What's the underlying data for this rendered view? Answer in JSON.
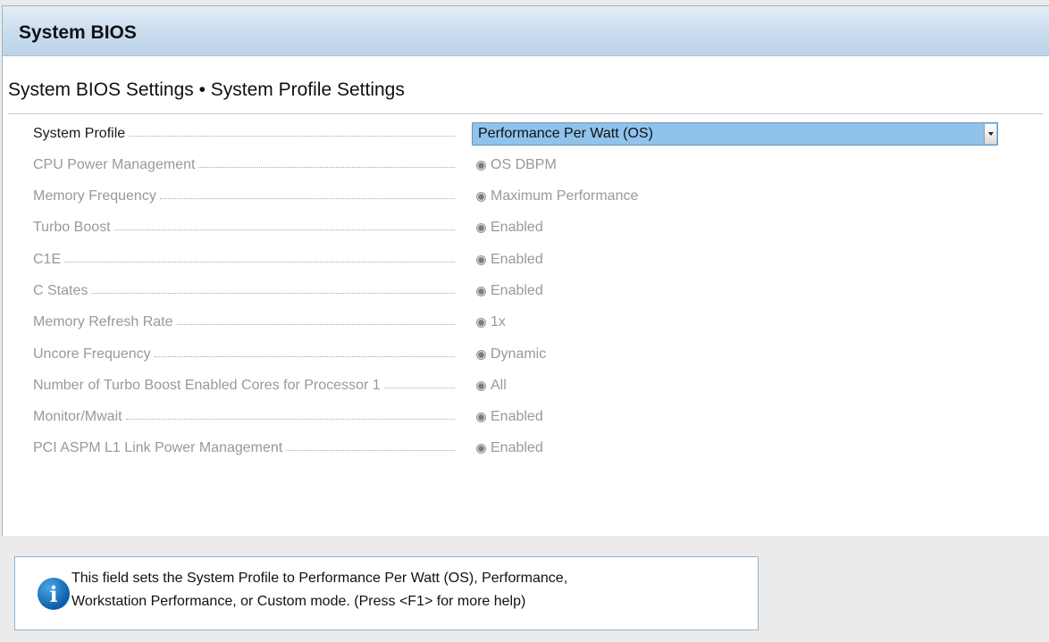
{
  "header": {
    "title": "System BIOS"
  },
  "section": {
    "title": "System BIOS Settings • System Profile Settings"
  },
  "settings": [
    {
      "label": "System Profile",
      "value": "Performance Per Watt (OS)",
      "type": "select",
      "active": true
    },
    {
      "label": "CPU Power Management",
      "value": "OS DBPM",
      "type": "radio",
      "active": false
    },
    {
      "label": "Memory Frequency",
      "value": "Maximum Performance",
      "type": "radio",
      "active": false
    },
    {
      "label": "Turbo Boost",
      "value": "Enabled",
      "type": "radio",
      "active": false
    },
    {
      "label": "C1E",
      "value": "Enabled",
      "type": "radio",
      "active": false
    },
    {
      "label": "C States",
      "value": "Enabled",
      "type": "radio",
      "active": false
    },
    {
      "label": "Memory Refresh Rate",
      "value": "1x",
      "type": "radio",
      "active": false
    },
    {
      "label": "Uncore Frequency",
      "value": "Dynamic",
      "type": "radio",
      "active": false
    },
    {
      "label": "Number of Turbo Boost Enabled Cores for Processor 1",
      "value": "All",
      "type": "radio",
      "active": false
    },
    {
      "label": "Monitor/Mwait",
      "value": "Enabled",
      "type": "radio",
      "active": false
    },
    {
      "label": "PCI ASPM L1 Link Power Management",
      "value": "Enabled",
      "type": "radio",
      "active": false
    }
  ],
  "help": {
    "icon": "info-icon",
    "text_line1": "This field sets the System Profile to Performance Per Watt (OS), Performance,",
    "text_line2": "Workstation Performance, or Custom mode. (Press <F1> for more help)"
  },
  "colors": {
    "header_gradient": "#c9dcee",
    "select_highlight": "#8fc3ec",
    "disabled_text": "#999999",
    "info_icon": "#0a5fa8"
  }
}
